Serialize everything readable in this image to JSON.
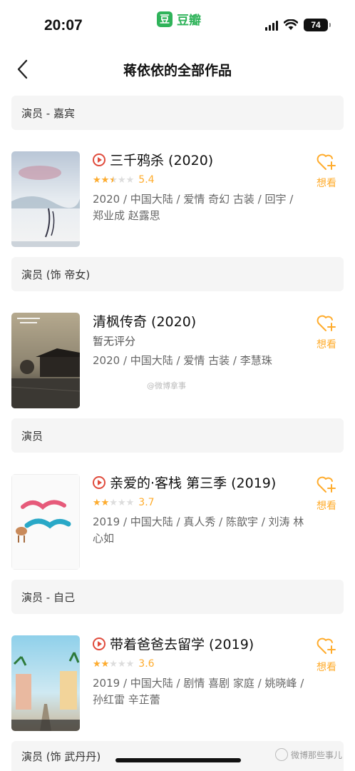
{
  "status_bar": {
    "time": "20:07",
    "app_badge": "豆",
    "app_name": "豆瓣",
    "battery": "74"
  },
  "nav": {
    "title": "蒋依依的全部作品",
    "back_icon": "chevron-left-icon"
  },
  "colors": {
    "accent": "#ffac2d",
    "play": "#e04b3c",
    "brand": "#2fb35a",
    "role_bg": "#f5f5f5"
  },
  "sections": [
    {
      "role": "演员 - 嘉宾",
      "work": {
        "title": "三千鸦杀 (2020)",
        "playable": true,
        "rating": "5.4",
        "stars": 2.5,
        "no_rating_text": "",
        "meta": "2020 / 中国大陆 / 爱情 奇幻 古装 / 回宇 / 郑业成 赵露思",
        "want_label": "想看"
      }
    },
    {
      "role": "演员 (饰 帝女)",
      "work": {
        "title": "清枫传奇 (2020)",
        "playable": false,
        "rating": "",
        "stars": 0,
        "no_rating_text": "暂无评分",
        "meta": "2020 / 中国大陆 / 爱情 古装 / 李慧珠",
        "want_label": "想看"
      }
    },
    {
      "role": "演员",
      "work": {
        "title": "亲爱的·客栈 第三季 (2019)",
        "playable": true,
        "rating": "3.7",
        "stars": 2,
        "no_rating_text": "",
        "meta": "2019 / 中国大陆 / 真人秀 / 陈歆宇 / 刘涛 林心如",
        "want_label": "想看"
      }
    },
    {
      "role": "演员 - 自己",
      "work": {
        "title": "带着爸爸去留学 (2019)",
        "playable": true,
        "rating": "3.6",
        "stars": 2,
        "no_rating_text": "",
        "meta": "2019 / 中国大陆 / 剧情 喜剧 家庭 / 姚晓峰 / 孙红雷 辛芷蕾",
        "want_label": "想看"
      }
    },
    {
      "role": "演员 (饰 武丹丹)"
    }
  ],
  "watermark": "@微博拿事",
  "corner_watermark": "微博那些事儿"
}
